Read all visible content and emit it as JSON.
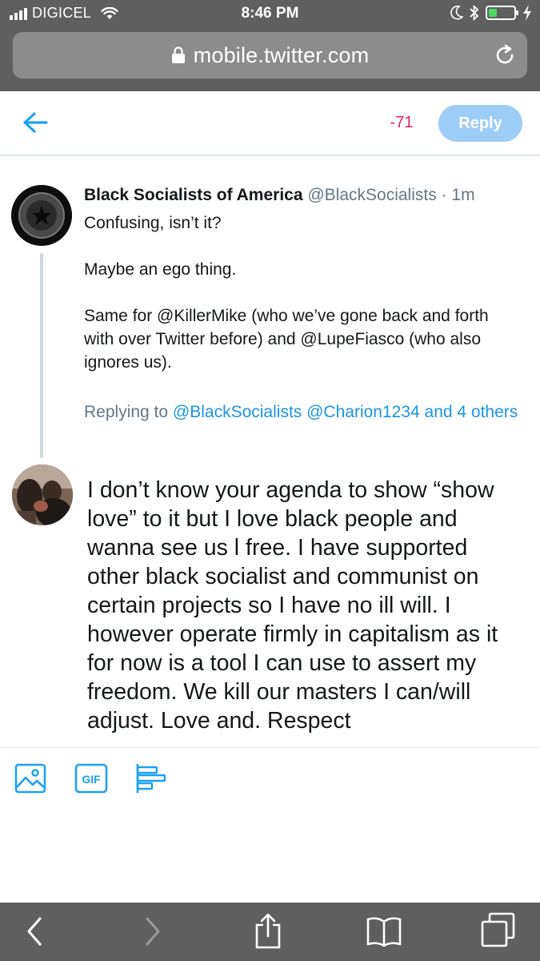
{
  "status_bar": {
    "carrier": "DIGICEL",
    "time": "8:46 PM"
  },
  "browser": {
    "url": "mobile.twitter.com"
  },
  "compose": {
    "char_count": "-71",
    "reply_button": "Reply"
  },
  "tweet": {
    "name": "Black Socialists of America",
    "handle": "@BlackSocialists",
    "time": "· 1m",
    "paragraphs": [
      "Confusing, isn’t it?",
      "Maybe an ego thing.",
      "Same for @KillerMike (who we’ve gone back and forth with over Twitter before) and @LupeFiasco (who also ignores us)."
    ],
    "replying_prefix": "Replying to",
    "replying_to": "@BlackSocialists @Charion1234 and 4 others"
  },
  "draft_reply": "I don’t know your agenda to show “show love” to it but I love black people and wanna see us l free. I have supported other black socialist and communist on certain projects so I have no ill will.  I however operate firmly in capitalism as it for now is a tool I can use to assert my freedom.  We kill our masters I can/will adjust.  Love and. Respect",
  "colors": {
    "twitter_blue": "#1da1f2",
    "reply_button_disabled": "#9ccdf6",
    "over_limit": "#e0245e",
    "browser_chrome": "#5f5f5f"
  },
  "icons": {
    "back": "arrow-left-icon",
    "lock": "lock-icon",
    "reload": "reload-icon",
    "image": "image-icon",
    "gif": "gif-icon",
    "poll": "poll-icon",
    "safari_back": "chevron-left-icon",
    "safari_forward": "chevron-right-icon",
    "share": "share-icon",
    "bookmarks": "book-icon",
    "tabs": "tabs-icon"
  }
}
